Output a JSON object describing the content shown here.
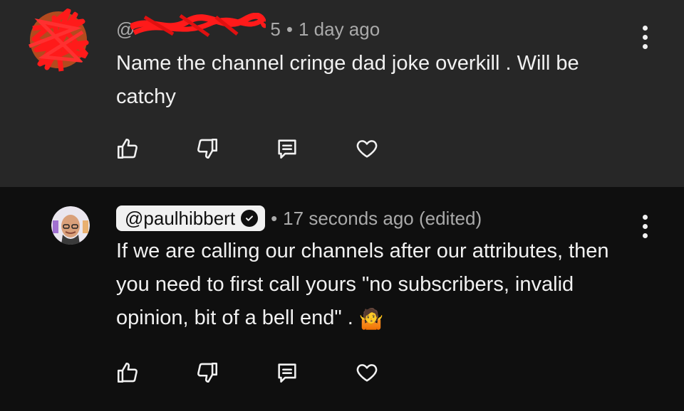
{
  "comments": [
    {
      "handle": "@",
      "handle_suffix": "5",
      "time": "1 day ago",
      "text": "Name the channel cringe dad joke overkill . Will be catchy",
      "avatar_color": "#e53935"
    },
    {
      "handle": "@paulhibbert",
      "verified": true,
      "time": "17 seconds ago (edited)",
      "text": "If we are calling our channels after our attributes, then you need to first call yours  \"no subscribers, invalid opinion, bit of a bell end\" . ",
      "emoji": "🤷"
    }
  ],
  "actions": [
    "thumbs-up-icon",
    "thumbs-down-icon",
    "reply-icon",
    "heart-icon"
  ],
  "colors": {
    "top_bg": "#272727",
    "bottom_bg": "#0f0f0f",
    "text": "#f1f1f1",
    "meta": "#aaaaaa",
    "redaction": "#ff1a1a"
  }
}
